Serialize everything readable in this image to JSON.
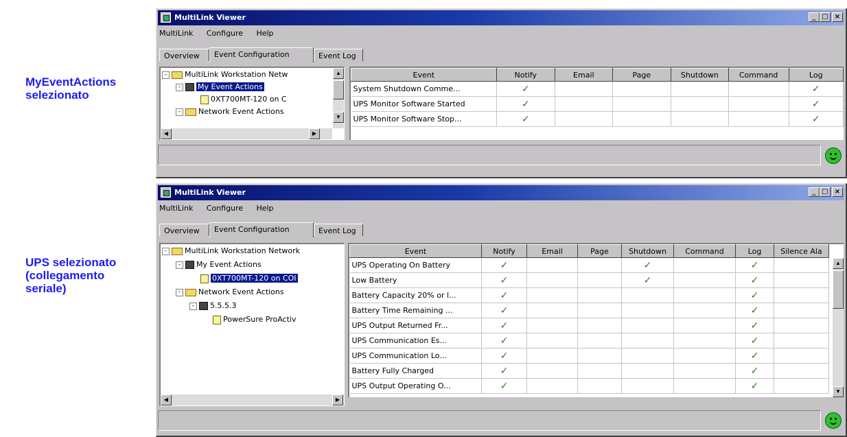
{
  "captions": {
    "top": [
      "MyEventActions",
      "selezionato"
    ],
    "bottom": [
      "UPS selezionato",
      "(collegamento",
      "seriale)"
    ]
  },
  "window": {
    "title": "MultiLink Viewer",
    "menu": [
      "MultiLink",
      "Configure",
      "Help"
    ],
    "tabs": [
      "Overview",
      "Event Configuration",
      "Event Log"
    ],
    "active_tab": "Event Configuration"
  },
  "panel1": {
    "tree": [
      {
        "label": "MultiLink Workstation Netw",
        "level": 0,
        "icon": "folder-icon",
        "expander": "-",
        "selected": false
      },
      {
        "label": "My Event Actions",
        "level": 1,
        "icon": "network-icon",
        "expander": "-",
        "selected": true
      },
      {
        "label": "0XT700MT-120 on C",
        "level": 2,
        "icon": "ups-device-icon",
        "expander": "",
        "selected": false
      },
      {
        "label": "Network Event Actions",
        "level": 1,
        "icon": "folder-icon",
        "expander": "-",
        "selected": false
      }
    ],
    "columns": [
      "Event",
      "Notify",
      "Email",
      "Page",
      "Shutdown",
      "Command",
      "Log"
    ],
    "rows": [
      {
        "event": "System Shutdown Comme...",
        "checks": [
          "✓",
          "",
          "",
          "",
          "",
          "✓"
        ]
      },
      {
        "event": "UPS Monitor Software Started",
        "checks": [
          "✓",
          "",
          "",
          "",
          "",
          "✓"
        ]
      },
      {
        "event": "UPS Monitor Software Stop...",
        "checks": [
          "✓",
          "",
          "",
          "",
          "",
          "✓"
        ]
      }
    ]
  },
  "panel2": {
    "tree": [
      {
        "label": "MultiLink Workstation Network",
        "level": 0,
        "icon": "folder-icon",
        "expander": "-",
        "selected": false
      },
      {
        "label": "My Event Actions",
        "level": 1,
        "icon": "network-icon",
        "expander": "-",
        "selected": false
      },
      {
        "label": "0XT700MT-120 on COI",
        "level": 2,
        "icon": "ups-device-icon",
        "expander": "",
        "selected": true
      },
      {
        "label": "Network Event Actions",
        "level": 1,
        "icon": "folder-icon",
        "expander": "-",
        "selected": false
      },
      {
        "label": "5.5.5.3",
        "level": 2,
        "icon": "network-icon",
        "expander": "-",
        "selected": false
      },
      {
        "label": "PowerSure ProActiv",
        "level": 3,
        "icon": "ups-device-icon",
        "expander": "",
        "selected": false
      }
    ],
    "columns": [
      "Event",
      "Notify",
      "Email",
      "Page",
      "Shutdown",
      "Command",
      "Log",
      "Silence Ala"
    ],
    "rows": [
      {
        "event": "UPS Operating On Battery",
        "checks": [
          "✓",
          "",
          "",
          "✓",
          "",
          "✓",
          ""
        ]
      },
      {
        "event": "Low Battery",
        "checks": [
          "✓",
          "",
          "",
          "✓",
          "",
          "✓",
          ""
        ]
      },
      {
        "event": "Battery Capacity 20% or l...",
        "checks": [
          "✓",
          "",
          "",
          "",
          "",
          "✓",
          ""
        ]
      },
      {
        "event": "Battery Time Remaining ...",
        "checks": [
          "✓",
          "",
          "",
          "",
          "",
          "✓",
          ""
        ]
      },
      {
        "event": "UPS Output Returned Fr...",
        "checks": [
          "✓",
          "",
          "",
          "",
          "",
          "✓",
          ""
        ]
      },
      {
        "event": "UPS Communication Es...",
        "checks": [
          "✓",
          "",
          "",
          "",
          "",
          "✓",
          ""
        ]
      },
      {
        "event": "UPS Communication Lo...",
        "checks": [
          "✓",
          "",
          "",
          "",
          "",
          "✓",
          ""
        ]
      },
      {
        "event": "Battery Fully Charged",
        "checks": [
          "✓",
          "",
          "",
          "",
          "",
          "✓",
          ""
        ]
      },
      {
        "event": "UPS Output Operating O...",
        "checks": [
          "✓",
          "",
          "",
          "",
          "",
          "✓",
          ""
        ]
      }
    ]
  },
  "colors": {
    "title_gradient_start": "#07106b",
    "title_gradient_end": "#8ea9e6",
    "selection": "#0a1a8c",
    "caption": "#1c1cf0",
    "status_ok": "#2ec02e"
  }
}
